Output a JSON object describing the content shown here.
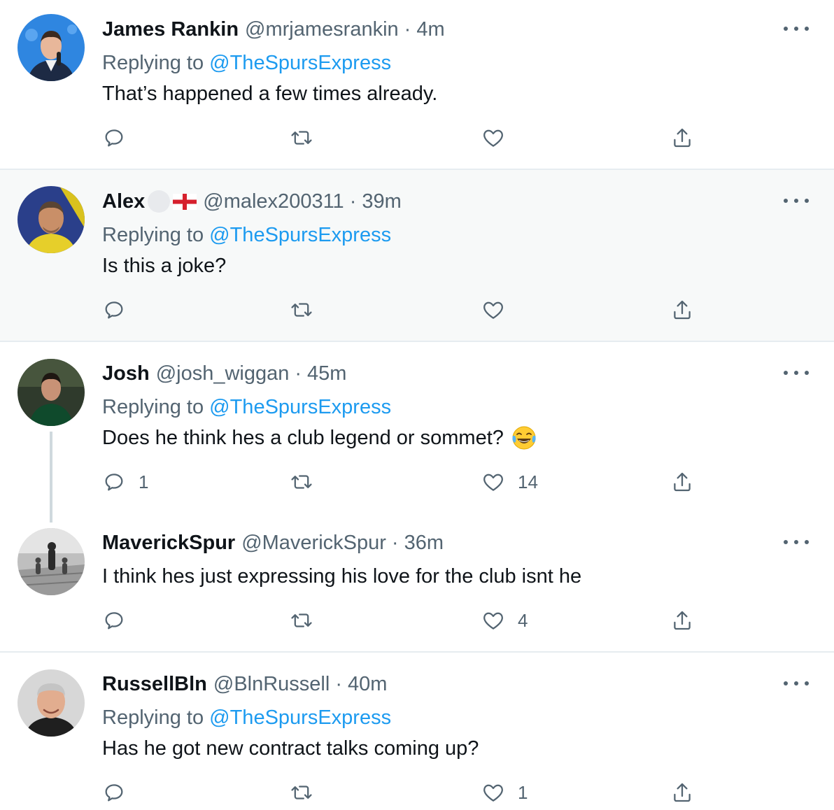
{
  "tweets": [
    {
      "name": "James Rankin",
      "handle": "@mrjamesrankin",
      "dot": "·",
      "time": "4m",
      "replying_label": "Replying to",
      "replying_to": "@TheSpursExpress",
      "text": "That’s happened a few times already.",
      "replies": "",
      "likes": ""
    },
    {
      "name": "Alex",
      "handle": "@malex200311",
      "dot": "·",
      "time": "39m",
      "replying_label": "Replying to",
      "replying_to": "@TheSpursExpress",
      "text": "Is this a joke?",
      "replies": "",
      "likes": ""
    },
    {
      "name": "Josh",
      "handle": "@josh_wiggan",
      "dot": "·",
      "time": "45m",
      "replying_label": "Replying to",
      "replying_to": "@TheSpursExpress",
      "text": "Does he think hes a club legend or sommet?",
      "replies": "1",
      "likes": "14"
    },
    {
      "name": "MaverickSpur",
      "handle": "@MaverickSpur",
      "dot": "·",
      "time": "36m",
      "text": "I think hes just expressing his love for the club isnt he",
      "replies": "",
      "likes": "4"
    },
    {
      "name": "RussellBln",
      "handle": "@BlnRussell",
      "dot": "·",
      "time": "40m",
      "replying_label": "Replying to",
      "replying_to": "@TheSpursExpress",
      "text": "Has he got new contract talks coming up?",
      "replies": "",
      "likes": "1"
    }
  ],
  "icons": {
    "reply": "reply-icon",
    "retweet": "retweet-icon",
    "like": "heart-icon",
    "share": "share-icon",
    "more": "more-icon"
  },
  "colors": {
    "link": "#1d9bf0",
    "secondary_text": "#536471",
    "highlight_bg": "#f7f9f9",
    "divider": "#e6ecf0"
  }
}
